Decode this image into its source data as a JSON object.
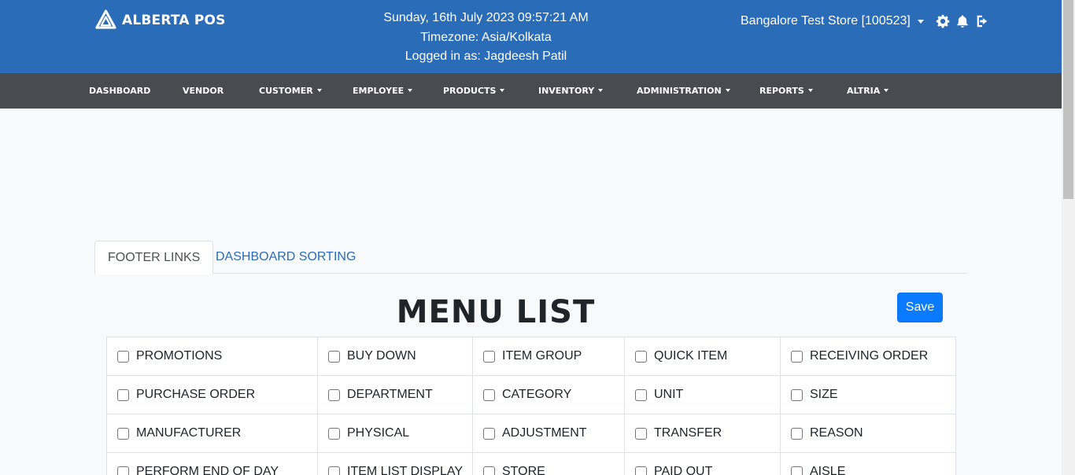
{
  "header": {
    "brand": "ALBERTA POS",
    "datetime": "Sunday, 16th July 2023 09:57:21 AM",
    "timezone": "Timezone: Asia/Kolkata",
    "logged_in": "Logged in as: Jagdeesh Patil",
    "store": "Bangalore Test Store [100523]",
    "icons": [
      "store-dropdown-caret-icon",
      "gear-icon",
      "bell-icon",
      "logout-icon"
    ]
  },
  "nav": {
    "items": [
      {
        "label": "DASHBOARD",
        "dropdown": false
      },
      {
        "label": "VENDOR",
        "dropdown": false
      },
      {
        "label": "CUSTOMER",
        "dropdown": true
      },
      {
        "label": "EMPLOYEE",
        "dropdown": true
      },
      {
        "label": "PRODUCTS",
        "dropdown": true
      },
      {
        "label": "INVENTORY",
        "dropdown": true
      },
      {
        "label": "ADMINISTRATION",
        "dropdown": true
      },
      {
        "label": "REPORTS",
        "dropdown": true
      },
      {
        "label": "ALTRIA",
        "dropdown": true
      }
    ]
  },
  "tabs": [
    {
      "label": "FOOTER LINKS",
      "active": true
    },
    {
      "label": "DASHBOARD SORTING",
      "active": false
    }
  ],
  "main": {
    "title": "MENU LIST",
    "save_label": "Save"
  },
  "menu_rows": [
    [
      "PROMOTIONS",
      "BUY DOWN",
      "ITEM GROUP",
      "QUICK ITEM",
      "RECEIVING ORDER"
    ],
    [
      "PURCHASE ORDER",
      "DEPARTMENT",
      "CATEGORY",
      "UNIT",
      "SIZE"
    ],
    [
      "MANUFACTURER",
      "PHYSICAL",
      "ADJUSTMENT",
      "TRANSFER",
      "REASON"
    ],
    [
      "PERFORM END OF DAY",
      "ITEM LIST DISPLAY",
      "STORE",
      "PAID OUT",
      "AISLE"
    ]
  ],
  "colors": {
    "header_bg": "#2a6cb7",
    "nav_bg": "#484b50",
    "primary_button": "#0a7aff",
    "page_bg": "#f8f9fa"
  }
}
